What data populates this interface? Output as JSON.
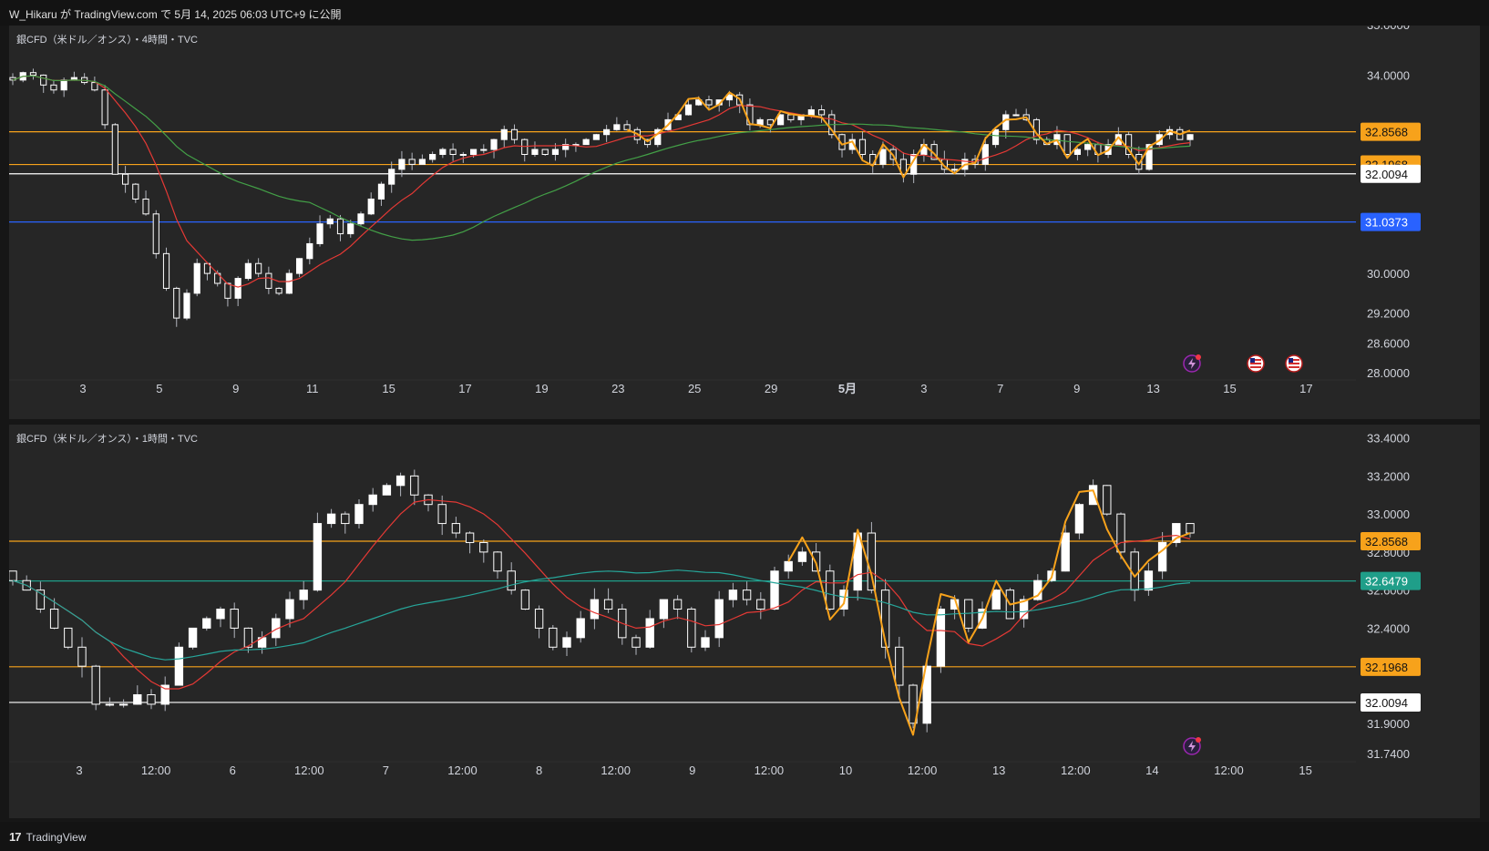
{
  "header": {
    "text": "W_Hikaru が TradingView.com で 5月 14, 2025 06:03 UTC+9 に公開"
  },
  "footer": {
    "brand": "TradingView",
    "mark": "17"
  },
  "colors": {
    "bg": "#262626",
    "up": "#ffffff",
    "down": "#ffffff",
    "wick": "#b2b5be",
    "orange": "#f7a21b",
    "blue": "#2962ff",
    "white": "#ffffff",
    "teal": "#1f9e89",
    "ma_fast": "#e53935",
    "ma_slow": "#43a047",
    "ma_slow2": "#26a69a"
  },
  "chart_data": [
    {
      "type": "candlestick",
      "title": "銀CFD（米ドル／オンス）・4時間・TVC",
      "x_ticks": [
        "3",
        "5",
        "9",
        "11",
        "15",
        "17",
        "19",
        "23",
        "25",
        "29",
        "5月",
        "3",
        "7",
        "9",
        "13",
        "15",
        "17"
      ],
      "y_ticks": [
        34.0,
        32.0,
        30.0,
        29.2,
        28.6,
        28.0
      ],
      "y_tick_labels": [
        "34.0000",
        "32.0000",
        "30.0000",
        "29.2000",
        "28.6000",
        "28.0000"
      ],
      "top_partial_label": "35.0000",
      "ylim": [
        27.65,
        35.0
      ],
      "price_lines": [
        {
          "value": 32.8568,
          "label": "32.8568",
          "color": "orange"
        },
        {
          "value": 32.1968,
          "label": "32.1968",
          "color": "orange"
        },
        {
          "value": 32.0094,
          "label": "32.0094",
          "color": "white"
        },
        {
          "value": 31.0373,
          "label": "31.0373",
          "color": "blue"
        }
      ],
      "close_path": [
        33.9,
        34.05,
        34.0,
        33.8,
        33.7,
        33.9,
        33.95,
        33.85,
        33.7,
        33.0,
        32.0,
        31.8,
        31.5,
        31.2,
        30.4,
        29.7,
        29.1,
        29.6,
        30.2,
        30.0,
        29.8,
        29.5,
        29.9,
        30.2,
        30.0,
        29.7,
        29.6,
        30.0,
        30.3,
        30.6,
        31.0,
        31.1,
        30.8,
        31.0,
        31.2,
        31.5,
        31.8,
        32.1,
        32.3,
        32.2,
        32.3,
        32.4,
        32.5,
        32.4,
        32.4,
        32.5,
        32.5,
        32.7,
        32.9,
        32.7,
        32.4,
        32.5,
        32.4,
        32.5,
        32.6,
        32.6,
        32.7,
        32.8,
        32.9,
        33.0,
        32.9,
        32.7,
        32.6,
        32.9,
        33.1,
        33.2,
        33.4,
        33.5,
        33.4,
        33.5,
        33.6,
        33.4,
        33.0,
        33.1,
        33.0,
        33.2,
        33.1,
        33.2,
        33.3,
        33.2,
        32.8,
        32.5,
        32.7,
        32.4,
        32.2,
        32.5,
        32.3,
        32.0,
        32.4,
        32.6,
        32.3,
        32.1,
        32.1,
        32.3,
        32.2,
        32.6,
        32.9,
        33.2,
        33.2,
        33.1,
        32.7,
        32.6,
        32.8,
        32.4,
        32.5,
        32.6,
        32.4,
        32.6,
        32.8,
        32.4,
        32.1,
        32.6,
        32.8,
        32.9,
        32.7,
        32.8
      ],
      "event_icons": [
        "flash-icon",
        "us-flag-icon",
        "us-flag-icon"
      ]
    },
    {
      "type": "candlestick",
      "title": "銀CFD（米ドル／オンス）・1時間・TVC",
      "x_ticks": [
        "3",
        "12:00",
        "6",
        "12:00",
        "7",
        "12:00",
        "8",
        "12:00",
        "9",
        "12:00",
        "10",
        "12:00",
        "13",
        "12:00",
        "14",
        "12:00",
        "15"
      ],
      "y_ticks": [
        33.4,
        33.2,
        33.0,
        32.8,
        32.6,
        32.4,
        32.0,
        31.9,
        31.74
      ],
      "y_tick_labels": [
        "33.4000",
        "33.2000",
        "33.0000",
        "32.8000",
        "32.6000",
        "32.4000",
        "32.0500",
        "31.9000",
        "31.7400"
      ],
      "ylim": [
        31.65,
        33.47
      ],
      "price_lines": [
        {
          "value": 32.8568,
          "label": "32.8568",
          "color": "orange"
        },
        {
          "value": 32.6479,
          "label": "32.6479",
          "color": "teal"
        },
        {
          "value": 32.1968,
          "label": "32.1968",
          "color": "orange"
        },
        {
          "value": 32.0094,
          "label": "32.0094",
          "color": "white"
        }
      ],
      "close_path": [
        32.65,
        32.6,
        32.5,
        32.4,
        32.3,
        32.2,
        32.0,
        32.0,
        32.0,
        32.05,
        32.0,
        32.1,
        32.3,
        32.4,
        32.45,
        32.5,
        32.4,
        32.3,
        32.35,
        32.45,
        32.55,
        32.6,
        32.95,
        33.0,
        32.95,
        33.05,
        33.1,
        33.15,
        33.2,
        33.1,
        33.05,
        32.95,
        32.9,
        32.85,
        32.8,
        32.7,
        32.6,
        32.5,
        32.4,
        32.3,
        32.35,
        32.45,
        32.55,
        32.5,
        32.35,
        32.3,
        32.45,
        32.55,
        32.5,
        32.3,
        32.35,
        32.55,
        32.6,
        32.55,
        32.5,
        32.7,
        32.75,
        32.8,
        32.7,
        32.5,
        32.6,
        32.9,
        32.6,
        32.3,
        32.1,
        31.9,
        32.2,
        32.5,
        32.55,
        32.4,
        32.5,
        32.6,
        32.45,
        32.55,
        32.65,
        32.7,
        32.9,
        33.05,
        33.15,
        33.0,
        32.8,
        32.6,
        32.7,
        32.85,
        32.95,
        32.9
      ],
      "event_icons": [
        "flash-icon"
      ]
    }
  ]
}
